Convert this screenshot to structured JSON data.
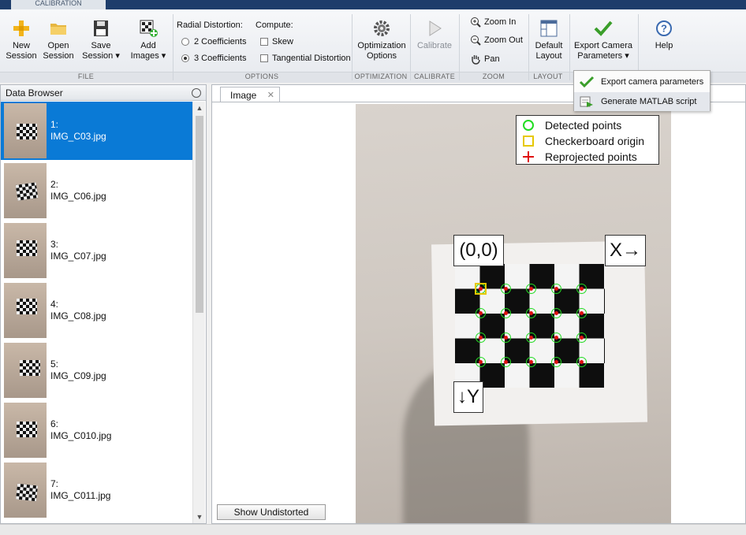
{
  "tab": {
    "label": "CALIBRATION"
  },
  "ribbon": {
    "file": {
      "label": "FILE",
      "new_session": "New\nSession",
      "open_session": "Open\nSession",
      "save_session": "Save\nSession ▾",
      "add_images": "Add\nImages ▾"
    },
    "options": {
      "label": "OPTIONS",
      "radial_title": "Radial Distortion:",
      "radial_2": "2 Coefficients",
      "radial_3": "3 Coefficients",
      "compute_title": "Compute:",
      "skew": "Skew",
      "tangential": "Tangential Distortion"
    },
    "optimization": {
      "label": "OPTIMIZATION",
      "button": "Optimization\nOptions"
    },
    "calibrate": {
      "label": "CALIBRATE",
      "button": "Calibrate"
    },
    "zoom": {
      "label": "ZOOM",
      "zoom_in": "Zoom In",
      "zoom_out": "Zoom Out",
      "pan": "Pan"
    },
    "layout": {
      "label": "LAYOUT",
      "button": "Default\nLayout"
    },
    "export": {
      "button": "Export Camera\nParameters ▾"
    },
    "help": {
      "button": "Help"
    }
  },
  "export_menu": {
    "items": [
      "Export camera parameters",
      "Generate MATLAB script"
    ]
  },
  "data_browser": {
    "title": "Data Browser",
    "items": [
      {
        "index": "1:",
        "name": "IMG_C03.jpg"
      },
      {
        "index": "2:",
        "name": "IMG_C06.jpg"
      },
      {
        "index": "3:",
        "name": "IMG_C07.jpg"
      },
      {
        "index": "4:",
        "name": "IMG_C08.jpg"
      },
      {
        "index": "5:",
        "name": "IMG_C09.jpg"
      },
      {
        "index": "6:",
        "name": "IMG_C010.jpg"
      },
      {
        "index": "7:",
        "name": "IMG_C011.jpg"
      }
    ]
  },
  "image_panel": {
    "tab_label": "Image",
    "legend": [
      "Detected points",
      "Checkerboard origin",
      "Reprojected points"
    ],
    "origin_label": "(0,0)",
    "x_label": "X→",
    "y_label": "↓Y",
    "show_undistorted": "Show Undistorted"
  },
  "colors": {
    "accent": "#0a7ad6",
    "detected": "#22dd22",
    "origin": "#e6c800",
    "reprojected": "#e01010"
  }
}
